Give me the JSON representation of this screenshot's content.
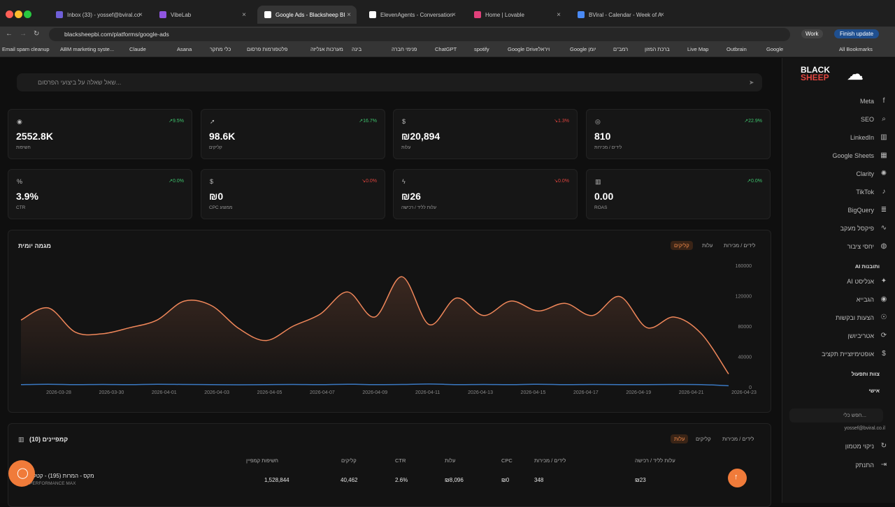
{
  "browser": {
    "tabs": [
      {
        "label": "Inbox (33) - yossef@bviral.co",
        "color": "#6f5fd8"
      },
      {
        "label": "VibeLab",
        "color": "#8f55e0"
      },
      {
        "label": "Google Ads - Blacksheep BI",
        "color": "#ffffff"
      },
      {
        "label": "ElevenAgents - Conversation",
        "color": "#ffffff"
      },
      {
        "label": "Home | Lovable",
        "color": "#e0407a"
      },
      {
        "label": "BViral - Calendar - Week of A",
        "color": "#4a8af4"
      }
    ],
    "url": "blacksheepbi.com/platforms/google-ads",
    "profile": "Work",
    "update": "Finish update",
    "bookmarks": [
      "Email spam cleanup",
      "ABM marketing syste...",
      "Claude",
      "Asana",
      "כלי מחקר",
      "פלטפורמות פרסום",
      "מערכות אנליזה",
      "בינה",
      "פנימי חברה",
      "ChatGPT",
      "spotify",
      "Google Driveויראל",
      "Google יומן",
      "רמב\"ם",
      "ברכת המזון",
      "Live Map",
      "Outbrain",
      "Google",
      "All Bookmarks"
    ]
  },
  "ask_placeholder": "שאל שאלה על ביצועי הפרסום...",
  "metrics": [
    {
      "icon": "eye-icon",
      "glyph": "◉",
      "value": "2552.8K",
      "label": "חשיפות",
      "trend": "9.5%",
      "dir": "up"
    },
    {
      "icon": "cursor-icon",
      "glyph": "➚",
      "value": "98.6K",
      "label": "קליקים",
      "trend": "16.7%",
      "dir": "up"
    },
    {
      "icon": "dollar-icon",
      "glyph": "$",
      "value": "₪20,894",
      "label": "עלות",
      "trend": "1.3%",
      "dir": "dn"
    },
    {
      "icon": "target-icon",
      "glyph": "◎",
      "value": "810",
      "label": "לידים / מכירות",
      "trend": "22.9%",
      "dir": "up"
    },
    {
      "icon": "percent-icon",
      "glyph": "%",
      "value": "3.9%",
      "label": "CTR",
      "trend": "0.0%",
      "dir": "up"
    },
    {
      "icon": "dollar-icon",
      "glyph": "$",
      "value": "₪0",
      "label": "CPC ממוצע",
      "trend": "0.0%",
      "dir": "dn"
    },
    {
      "icon": "bolt-icon",
      "glyph": "ϟ",
      "value": "₪26",
      "label": "עלות לליד / רכישה",
      "trend": "0.0%",
      "dir": "dn"
    },
    {
      "icon": "bars-icon",
      "glyph": "▥",
      "value": "0.00",
      "label": "ROAS",
      "trend": "0.0%",
      "dir": "up"
    }
  ],
  "chart_data": {
    "type": "line",
    "title": "מגמה יומית",
    "toggles": [
      "לידים / מכירות",
      "עלות",
      "קליקים"
    ],
    "active": "קליקים",
    "x": [
      "2026-03-27",
      "2026-03-28",
      "2026-03-29",
      "2026-03-30",
      "2026-03-31",
      "2026-04-01",
      "2026-04-02",
      "2026-04-03",
      "2026-04-04",
      "2026-04-05",
      "2026-04-06",
      "2026-04-07",
      "2026-04-08",
      "2026-04-09",
      "2026-04-10",
      "2026-04-11",
      "2026-04-12",
      "2026-04-13",
      "2026-04-14",
      "2026-04-15",
      "2026-04-16",
      "2026-04-17",
      "2026-04-18",
      "2026-04-19",
      "2026-04-20",
      "2026-04-21",
      "2026-04-22",
      "2026-04-23"
    ],
    "xticks": [
      "2026-03-28",
      "2026-03-30",
      "2026-04-01",
      "2026-04-03",
      "2026-04-05",
      "2026-04-07",
      "2026-04-09",
      "2026-04-11",
      "2026-04-13",
      "2026-04-15",
      "2026-04-17",
      "2026-04-19",
      "2026-04-21",
      "2026-04-23"
    ],
    "series": [
      {
        "values": [
          88000,
          104000,
          72000,
          70000,
          78000,
          88000,
          113000,
          107000,
          77000,
          61000,
          80000,
          96000,
          125000,
          92000,
          145000,
          82000,
          117000,
          94000,
          113000,
          100000,
          110000,
          94000,
          119000,
          78000,
          92000,
          70000,
          17000
        ],
        "color": "#f0875a"
      },
      {
        "values": [
          3000,
          3500,
          3000,
          3200,
          3000,
          3500,
          3200,
          3000,
          2800,
          3000,
          3200,
          3000,
          3500,
          3000,
          3200,
          3800,
          3000,
          3200,
          3000,
          3500,
          3000,
          3200,
          3000,
          3000,
          3200,
          3000,
          1500
        ],
        "color": "#3a78c2"
      }
    ],
    "ylim": [
      0,
      160000
    ],
    "yticks": [
      "0",
      "40000",
      "80000",
      "120000",
      "160000"
    ]
  },
  "campaigns": {
    "title": "קמפיינים (10)",
    "toggles": [
      "לידים / מכירות",
      "קליקים",
      "עלות"
    ],
    "active": "עלות",
    "headers": [
      "חשיפות קמפיין",
      "קליקים",
      "CTR",
      "עלות",
      "CPC",
      "לידים / מכירות",
      "עלות לליד / רכישה"
    ],
    "row": {
      "name": "מקס - המרות (195) - קטלוג",
      "type": "PERFORMANCE MAX",
      "cells": [
        "1,528,844",
        "40,462",
        "2.6%",
        "₪8,096",
        "₪0",
        "348",
        "₪23"
      ]
    }
  },
  "sidebar": {
    "items": [
      {
        "label": "Meta",
        "glyph": "f"
      },
      {
        "label": "SEO",
        "glyph": "⌕"
      },
      {
        "label": "LinkedIn",
        "glyph": "▥"
      },
      {
        "label": "Google Sheets",
        "glyph": "▦"
      },
      {
        "label": "Clarity",
        "glyph": "✺"
      },
      {
        "label": "TikTok",
        "glyph": "♪"
      },
      {
        "label": "BigQuery",
        "glyph": "≣"
      },
      {
        "label": "פיקסל מעקב",
        "glyph": "∿"
      },
      {
        "label": "יחסי ציבור",
        "glyph": "◍"
      }
    ],
    "ai_header": "AI ותובנות",
    "ai_items": [
      {
        "label": "AI אנליסט",
        "glyph": "✦"
      },
      {
        "label": "הגבייא",
        "glyph": "◉"
      },
      {
        "label": "הצעות ובקשות",
        "glyph": "☉"
      },
      {
        "label": "אטריביושן",
        "glyph": "⟳"
      },
      {
        "label": "אופטימיזציית תקציב",
        "glyph": "$"
      }
    ],
    "team": "צוות ותפעול",
    "personal": "אישי",
    "search": "חפש כלי...",
    "email": "yossef@bviral.co.il",
    "cache": "ניקוי מטמון",
    "logout": "התנתק"
  }
}
